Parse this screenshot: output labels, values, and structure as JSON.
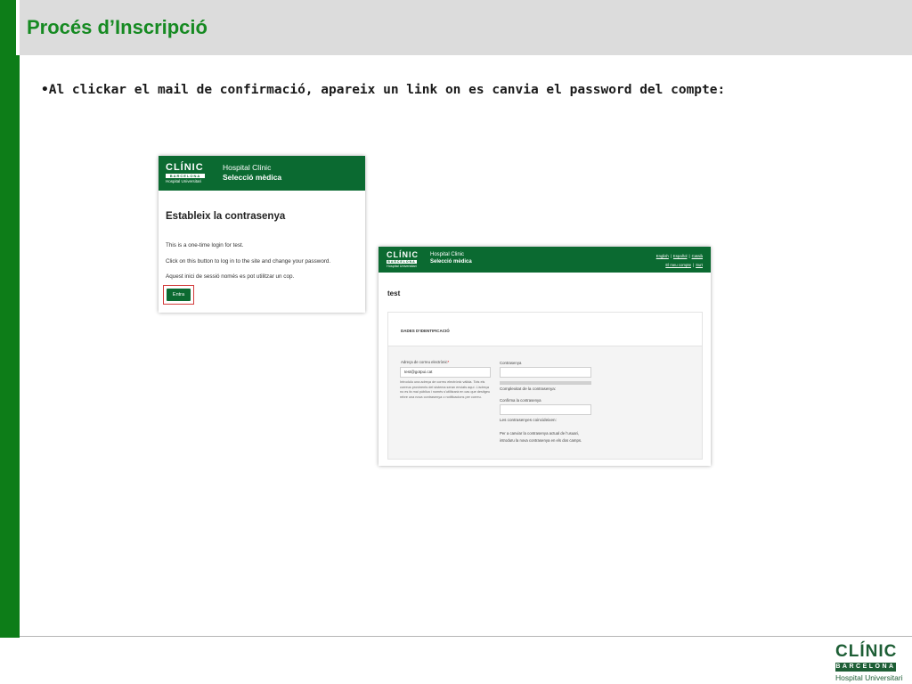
{
  "slide": {
    "title": "Procés d’Inscripció",
    "bullet": "•Al clickar el mail de confirmació, apareix un link on es canvia el password del compte:"
  },
  "footer_logo": {
    "name": "CLÍNIC",
    "city": "BARCELONA",
    "subtitle": "Hospital Universitari"
  },
  "screenshot_login": {
    "logo_name": "CLÍNIC",
    "logo_city": "BARCELONA",
    "logo_subtitle": "Hospital Universitari",
    "site_line1": "Hospital Clínic",
    "site_line2": "Selecció mèdica",
    "heading": "Estableix la contrasenya",
    "line1": "This is a one-time login for test.",
    "line2": "Click on this button to log in to the site and change your password.",
    "line3": "Aquest inici de sessió només es pot utilitzar un cop.",
    "button_label": "Entra"
  },
  "screenshot_profile": {
    "logo_name": "CLÍNIC",
    "logo_city": "BARCELONA",
    "logo_subtitle": "Hospital Universitari",
    "site_line1": "Hospital Clinic",
    "site_line2": "Selecció mèdica",
    "lang_english": "English",
    "lang_spanish": "Español",
    "lang_catalan": "Català",
    "link_account": "El meu compte",
    "link_logout": "Surt",
    "username": "test",
    "section_title": "DADES D’IDENTIFICACIÓ",
    "email_label": "Adreça de correu electrònic",
    "email_required": "*",
    "email_value": "test@gotpui.cat",
    "email_help": "Introduïu una adreça de correu electrònic vàlida. Tots els correus provinents del sistema seran enviats aquí. L’adreça no es fa mai pública i només s’utilitzarà en cas que desitgeu rebre una nova contrasenya o notificacions per correu.",
    "password_label": "Contrasenya",
    "strength_label": "Complexitat de la contrasenya:",
    "confirm_label": "Confirma la contrasenya",
    "match_text": "Les contrasenyes coincideixen:",
    "note_line1": "Per a canviar la contrasenya actual de l’usuari,",
    "note_line2": "introduïu la nova contrasenya en els dos camps."
  }
}
